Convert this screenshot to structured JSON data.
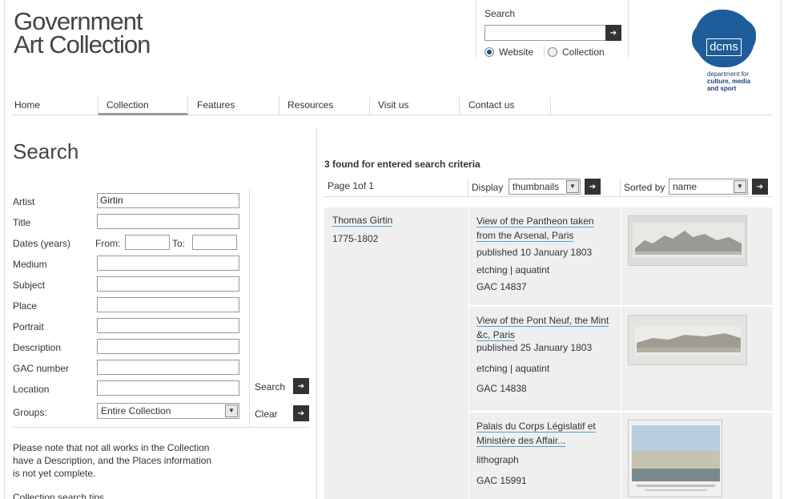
{
  "header": {
    "logo_line1": "Government",
    "logo_line2": "Art Collection",
    "search_label": "Search",
    "search_value": "",
    "scope_options": [
      "Website",
      "Collection"
    ],
    "scope_selected": "Website",
    "sponsor_mark": "dcms",
    "sponsor_line1": "department for",
    "sponsor_line2": "culture, media",
    "sponsor_line3": "and sport"
  },
  "nav": [
    "Home",
    "Collection",
    "Features",
    "Resources",
    "Visit us",
    "Contact us"
  ],
  "nav_active": "Collection",
  "search_form": {
    "title": "Search",
    "fields": {
      "artist": {
        "label": "Artist",
        "value": "Girtin"
      },
      "title": {
        "label": "Title",
        "value": ""
      },
      "dates": {
        "label": "Dates (years)",
        "from_label": "From:",
        "to_label": "To:",
        "from": "",
        "to": ""
      },
      "medium": {
        "label": "Medium",
        "value": ""
      },
      "subject": {
        "label": "Subject",
        "value": ""
      },
      "place": {
        "label": "Place",
        "value": ""
      },
      "portrait": {
        "label": "Portrait",
        "value": ""
      },
      "description": {
        "label": "Description",
        "value": ""
      },
      "gac_number": {
        "label": "GAC number",
        "value": ""
      },
      "location": {
        "label": "Location",
        "value": ""
      },
      "groups": {
        "label": "Groups:",
        "value": "Entire Collection"
      }
    },
    "search_label": "Search",
    "clear_label": "Clear",
    "note": "Please note that not all works in the Collection have a Description, and the Places information is not yet complete.",
    "tips_label": "Collection search tips"
  },
  "results": {
    "summary": "3 found for entered search criteria",
    "page": "Page 1of 1",
    "display_label": "Display",
    "display_value": "thumbnails",
    "sort_label": "Sorted by",
    "sort_value": "name",
    "artist": {
      "name": "Thomas Girtin",
      "dates": "1775-1802"
    },
    "items": [
      {
        "title": "View of the Pantheon taken from the Arsenal, Paris",
        "published": "published 10 January 1803",
        "medium": "etching | aquatint",
        "gac": "GAC 14837"
      },
      {
        "title": "View of the Pont Neuf, the Mint &c, Paris",
        "published": "published 25 January 1803",
        "medium": "etching | aquatint",
        "gac": "GAC 14838"
      },
      {
        "title": "Palais du Corps Législatif et Ministère des Affair...",
        "published": "",
        "medium": "lithograph",
        "gac": "GAC 15991"
      }
    ]
  },
  "colors": {
    "link_underline": "#4aa3c7",
    "panel_bg": "#efefef",
    "button_bg": "#333333",
    "dcms_blue": "#1f5c9a"
  }
}
